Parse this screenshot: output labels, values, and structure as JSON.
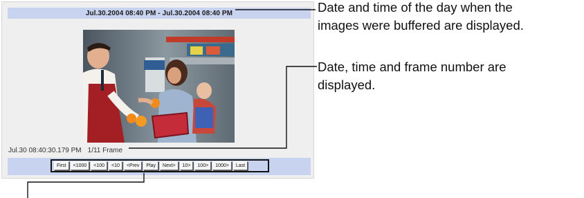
{
  "viewer": {
    "header": "Jul.30.2004 08:40 PM - Jul.30.2004 08:40 PM",
    "frame_timestamp": "Jul.30 08:40:30.179 PM",
    "frame_counter": "1/11 Frame",
    "image_description": "Photo of a grocery store clerk handing oranges to a woman holding a child"
  },
  "navigation": {
    "buttons": [
      "First",
      "<1000",
      "<100",
      "<10",
      "<Prev",
      "Play",
      "Next>",
      "10>",
      "100>",
      "1000>",
      "Last"
    ]
  },
  "callouts": {
    "header_note_line1": "Date and time of the day when the",
    "header_note_line2": "images were buffered are displayed.",
    "frame_note_line1": "Date, time and frame number are",
    "frame_note_line2": "displayed."
  },
  "colors": {
    "bar_background": "#c8d3f0",
    "viewer_background": "#efefef"
  }
}
